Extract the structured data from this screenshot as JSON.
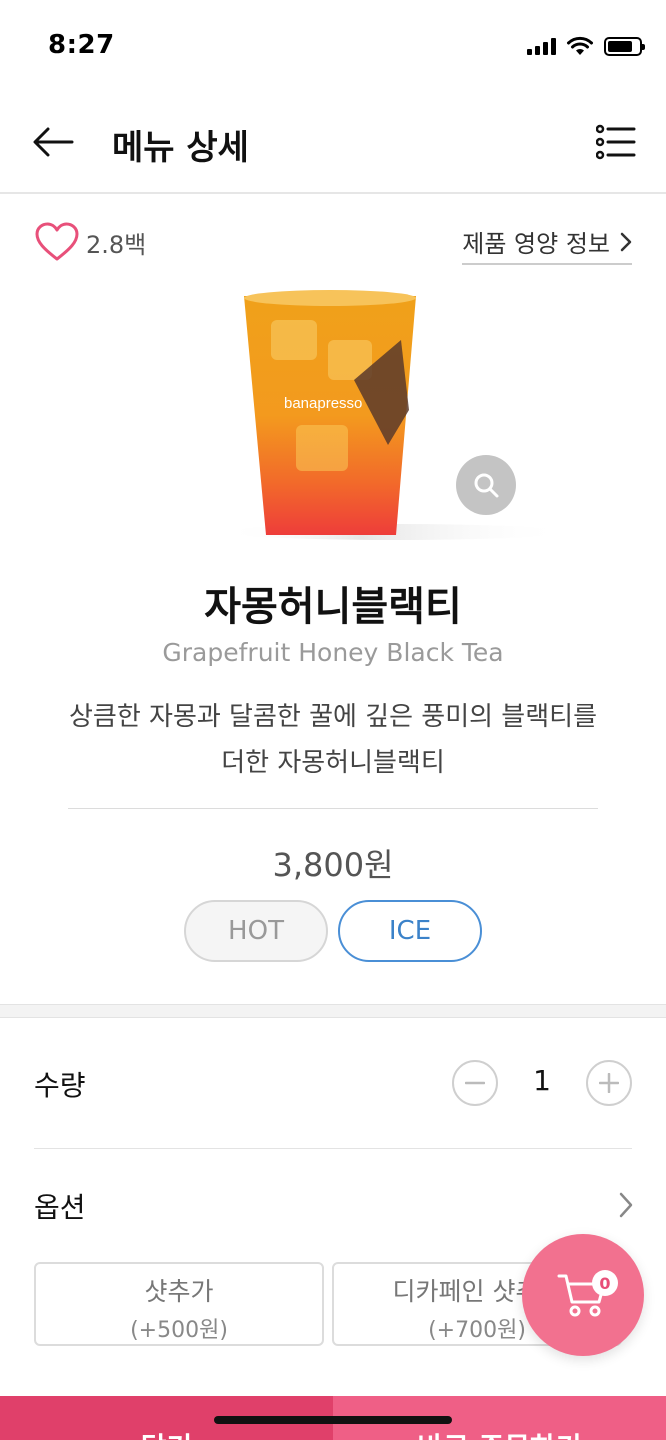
{
  "status": {
    "time": "8:27"
  },
  "header": {
    "title": "메뉴 상세"
  },
  "product": {
    "like_count": "2.8백",
    "nutrition_link": "제품 영양 정보",
    "brand_on_cup": "banapresso",
    "name": "자몽허니블랙티",
    "name_en": "Grapefruit Honey Black Tea",
    "description": "상큼한 자몽과 달콤한 꿀에 깊은 풍미의 블랙티를 더한 자몽허니블랙티",
    "price": "3,800원",
    "temperature": {
      "hot_label": "HOT",
      "ice_label": "ICE",
      "selected": "ICE"
    }
  },
  "quantity": {
    "label": "수량",
    "value": "1"
  },
  "options": {
    "label": "옵션",
    "items": [
      {
        "name": "샷추가",
        "price": "(+500원)"
      },
      {
        "name": "디카페인 샷추가",
        "price": "(+700원)"
      }
    ]
  },
  "cart": {
    "badge_count": "0"
  },
  "bottom_bar": {
    "cart_label": "담기",
    "order_label": "바로 주문하기"
  },
  "colors": {
    "accent_pink": "#e0406a",
    "fab_pink": "#f2718f",
    "ice_blue": "#3b82c9"
  }
}
